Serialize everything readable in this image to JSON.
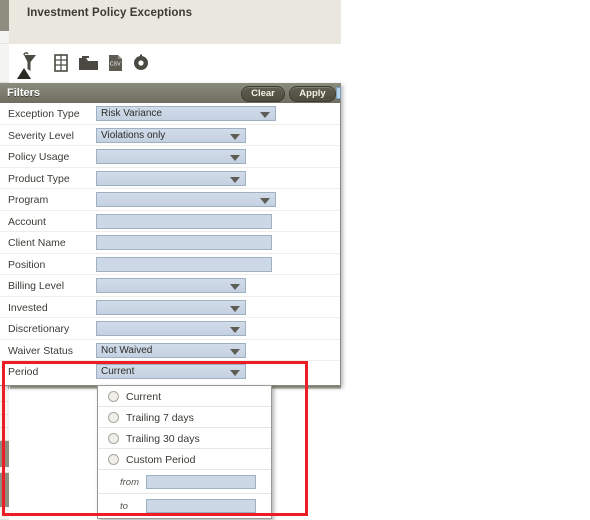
{
  "page": {
    "title": "Investment Policy Exceptions"
  },
  "toolbar": {
    "items": [
      {
        "name": "filter-funnel-icon",
        "label": "Filter"
      },
      {
        "name": "grid-icon",
        "label": "Grid"
      },
      {
        "name": "folder-icon",
        "label": "Folder"
      },
      {
        "name": "csv-export-icon",
        "label": "CSV"
      },
      {
        "name": "settings-icon",
        "label": "Settings"
      }
    ]
  },
  "filters": {
    "header_label": "Filters",
    "clear_label": "Clear",
    "apply_label": "Apply",
    "rows": [
      {
        "label": "Exception Type",
        "type": "select",
        "value": "Risk Variance",
        "width": "w-wide"
      },
      {
        "label": "Severity Level",
        "type": "select",
        "value": "Violations only",
        "width": "w-mid"
      },
      {
        "label": "Policy Usage",
        "type": "select",
        "value": "",
        "width": "w-mid"
      },
      {
        "label": "Product Type",
        "type": "select",
        "value": "",
        "width": "w-mid"
      },
      {
        "label": "Program",
        "type": "select",
        "value": "",
        "width": "w-wide"
      },
      {
        "label": "Account",
        "type": "text",
        "value": "",
        "width": "w-text"
      },
      {
        "label": "Client Name",
        "type": "text",
        "value": "",
        "width": "w-text"
      },
      {
        "label": "Position",
        "type": "text",
        "value": "",
        "width": "w-text"
      },
      {
        "label": "Billing Level",
        "type": "select",
        "value": "",
        "width": "w-mid"
      },
      {
        "label": "Invested",
        "type": "select",
        "value": "",
        "width": "w-mid"
      },
      {
        "label": "Discretionary",
        "type": "select",
        "value": "",
        "width": "w-mid"
      },
      {
        "label": "Waiver Status",
        "type": "select",
        "value": "Not Waived",
        "width": "w-mid"
      },
      {
        "label": "Period",
        "type": "select",
        "value": "Current",
        "width": "w-mid"
      }
    ]
  },
  "period_dropdown": {
    "options": [
      {
        "label": "Current",
        "selected": false
      },
      {
        "label": "Trailing 7 days",
        "selected": false
      },
      {
        "label": "Trailing 30 days",
        "selected": false
      },
      {
        "label": "Custom Period",
        "selected": false
      }
    ],
    "custom_from_label": "from",
    "custom_from_value": "",
    "custom_to_label": "to",
    "custom_to_value": ""
  },
  "annotation": {
    "color": "#ee1c24"
  }
}
